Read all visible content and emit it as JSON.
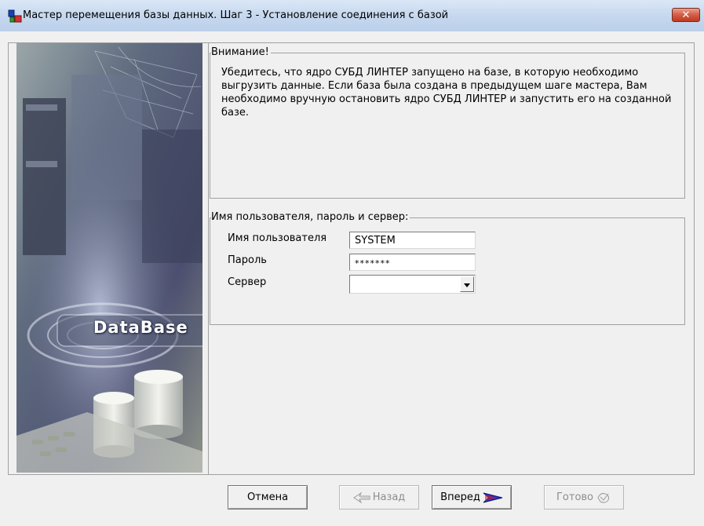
{
  "window": {
    "title": "Мастер перемещения базы данных. Шаг 3 - Установление соединения с базой",
    "close_symbol": "✕"
  },
  "icons": {
    "app": "database-wizard-icon",
    "close": "close-icon",
    "back": "back-arrow-icon",
    "next": "next-arrow-icon",
    "finish": "finish-icon"
  },
  "sidebar": {
    "image_caption": "DataBase"
  },
  "notice": {
    "legend": "Внимание!",
    "text": "Убедитесь, что ядро СУБД ЛИНТЕР запущено на базе, в которую необходимо выгрузить данные. Если база была создана в предыдущем шаге мастера, Вам необходимо вручную остановить ядро СУБД ЛИНТЕР и запустить его на созданной базе."
  },
  "credentials": {
    "legend": "Имя пользователя, пароль и сервер:",
    "username_label": "Имя пользователя",
    "username_value": "SYSTEM",
    "password_label": "Пароль",
    "password_value": "*******",
    "server_label": "Сервер",
    "server_value": ""
  },
  "buttons": {
    "cancel": "Отмена",
    "back": "Назад",
    "next": "Вперед",
    "finish": "Готово"
  },
  "colors": {
    "accent_arrow": "#1a2fd0",
    "title_bar": "#c5d7ee",
    "close_button": "#d4624b"
  }
}
